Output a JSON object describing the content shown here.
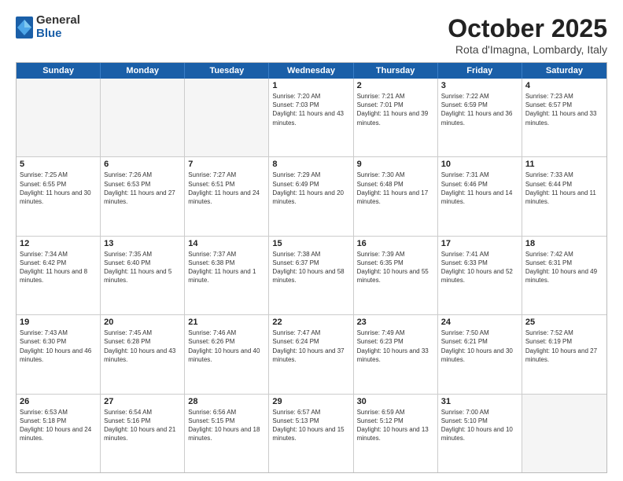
{
  "header": {
    "logo": {
      "general": "General",
      "blue": "Blue"
    },
    "title": "October 2025",
    "location": "Rota d'Imagna, Lombardy, Italy"
  },
  "days_of_week": [
    "Sunday",
    "Monday",
    "Tuesday",
    "Wednesday",
    "Thursday",
    "Friday",
    "Saturday"
  ],
  "weeks": [
    [
      {
        "day": "",
        "sunrise": "",
        "sunset": "",
        "daylight": "",
        "empty": true
      },
      {
        "day": "",
        "sunrise": "",
        "sunset": "",
        "daylight": "",
        "empty": true
      },
      {
        "day": "",
        "sunrise": "",
        "sunset": "",
        "daylight": "",
        "empty": true
      },
      {
        "day": "1",
        "sunrise": "Sunrise: 7:20 AM",
        "sunset": "Sunset: 7:03 PM",
        "daylight": "Daylight: 11 hours and 43 minutes."
      },
      {
        "day": "2",
        "sunrise": "Sunrise: 7:21 AM",
        "sunset": "Sunset: 7:01 PM",
        "daylight": "Daylight: 11 hours and 39 minutes."
      },
      {
        "day": "3",
        "sunrise": "Sunrise: 7:22 AM",
        "sunset": "Sunset: 6:59 PM",
        "daylight": "Daylight: 11 hours and 36 minutes."
      },
      {
        "day": "4",
        "sunrise": "Sunrise: 7:23 AM",
        "sunset": "Sunset: 6:57 PM",
        "daylight": "Daylight: 11 hours and 33 minutes."
      }
    ],
    [
      {
        "day": "5",
        "sunrise": "Sunrise: 7:25 AM",
        "sunset": "Sunset: 6:55 PM",
        "daylight": "Daylight: 11 hours and 30 minutes."
      },
      {
        "day": "6",
        "sunrise": "Sunrise: 7:26 AM",
        "sunset": "Sunset: 6:53 PM",
        "daylight": "Daylight: 11 hours and 27 minutes."
      },
      {
        "day": "7",
        "sunrise": "Sunrise: 7:27 AM",
        "sunset": "Sunset: 6:51 PM",
        "daylight": "Daylight: 11 hours and 24 minutes."
      },
      {
        "day": "8",
        "sunrise": "Sunrise: 7:29 AM",
        "sunset": "Sunset: 6:49 PM",
        "daylight": "Daylight: 11 hours and 20 minutes."
      },
      {
        "day": "9",
        "sunrise": "Sunrise: 7:30 AM",
        "sunset": "Sunset: 6:48 PM",
        "daylight": "Daylight: 11 hours and 17 minutes."
      },
      {
        "day": "10",
        "sunrise": "Sunrise: 7:31 AM",
        "sunset": "Sunset: 6:46 PM",
        "daylight": "Daylight: 11 hours and 14 minutes."
      },
      {
        "day": "11",
        "sunrise": "Sunrise: 7:33 AM",
        "sunset": "Sunset: 6:44 PM",
        "daylight": "Daylight: 11 hours and 11 minutes."
      }
    ],
    [
      {
        "day": "12",
        "sunrise": "Sunrise: 7:34 AM",
        "sunset": "Sunset: 6:42 PM",
        "daylight": "Daylight: 11 hours and 8 minutes."
      },
      {
        "day": "13",
        "sunrise": "Sunrise: 7:35 AM",
        "sunset": "Sunset: 6:40 PM",
        "daylight": "Daylight: 11 hours and 5 minutes."
      },
      {
        "day": "14",
        "sunrise": "Sunrise: 7:37 AM",
        "sunset": "Sunset: 6:38 PM",
        "daylight": "Daylight: 11 hours and 1 minute."
      },
      {
        "day": "15",
        "sunrise": "Sunrise: 7:38 AM",
        "sunset": "Sunset: 6:37 PM",
        "daylight": "Daylight: 10 hours and 58 minutes."
      },
      {
        "day": "16",
        "sunrise": "Sunrise: 7:39 AM",
        "sunset": "Sunset: 6:35 PM",
        "daylight": "Daylight: 10 hours and 55 minutes."
      },
      {
        "day": "17",
        "sunrise": "Sunrise: 7:41 AM",
        "sunset": "Sunset: 6:33 PM",
        "daylight": "Daylight: 10 hours and 52 minutes."
      },
      {
        "day": "18",
        "sunrise": "Sunrise: 7:42 AM",
        "sunset": "Sunset: 6:31 PM",
        "daylight": "Daylight: 10 hours and 49 minutes."
      }
    ],
    [
      {
        "day": "19",
        "sunrise": "Sunrise: 7:43 AM",
        "sunset": "Sunset: 6:30 PM",
        "daylight": "Daylight: 10 hours and 46 minutes."
      },
      {
        "day": "20",
        "sunrise": "Sunrise: 7:45 AM",
        "sunset": "Sunset: 6:28 PM",
        "daylight": "Daylight: 10 hours and 43 minutes."
      },
      {
        "day": "21",
        "sunrise": "Sunrise: 7:46 AM",
        "sunset": "Sunset: 6:26 PM",
        "daylight": "Daylight: 10 hours and 40 minutes."
      },
      {
        "day": "22",
        "sunrise": "Sunrise: 7:47 AM",
        "sunset": "Sunset: 6:24 PM",
        "daylight": "Daylight: 10 hours and 37 minutes."
      },
      {
        "day": "23",
        "sunrise": "Sunrise: 7:49 AM",
        "sunset": "Sunset: 6:23 PM",
        "daylight": "Daylight: 10 hours and 33 minutes."
      },
      {
        "day": "24",
        "sunrise": "Sunrise: 7:50 AM",
        "sunset": "Sunset: 6:21 PM",
        "daylight": "Daylight: 10 hours and 30 minutes."
      },
      {
        "day": "25",
        "sunrise": "Sunrise: 7:52 AM",
        "sunset": "Sunset: 6:19 PM",
        "daylight": "Daylight: 10 hours and 27 minutes."
      }
    ],
    [
      {
        "day": "26",
        "sunrise": "Sunrise: 6:53 AM",
        "sunset": "Sunset: 5:18 PM",
        "daylight": "Daylight: 10 hours and 24 minutes."
      },
      {
        "day": "27",
        "sunrise": "Sunrise: 6:54 AM",
        "sunset": "Sunset: 5:16 PM",
        "daylight": "Daylight: 10 hours and 21 minutes."
      },
      {
        "day": "28",
        "sunrise": "Sunrise: 6:56 AM",
        "sunset": "Sunset: 5:15 PM",
        "daylight": "Daylight: 10 hours and 18 minutes."
      },
      {
        "day": "29",
        "sunrise": "Sunrise: 6:57 AM",
        "sunset": "Sunset: 5:13 PM",
        "daylight": "Daylight: 10 hours and 15 minutes."
      },
      {
        "day": "30",
        "sunrise": "Sunrise: 6:59 AM",
        "sunset": "Sunset: 5:12 PM",
        "daylight": "Daylight: 10 hours and 13 minutes."
      },
      {
        "day": "31",
        "sunrise": "Sunrise: 7:00 AM",
        "sunset": "Sunset: 5:10 PM",
        "daylight": "Daylight: 10 hours and 10 minutes."
      },
      {
        "day": "",
        "sunrise": "",
        "sunset": "",
        "daylight": "",
        "empty": true
      }
    ]
  ]
}
